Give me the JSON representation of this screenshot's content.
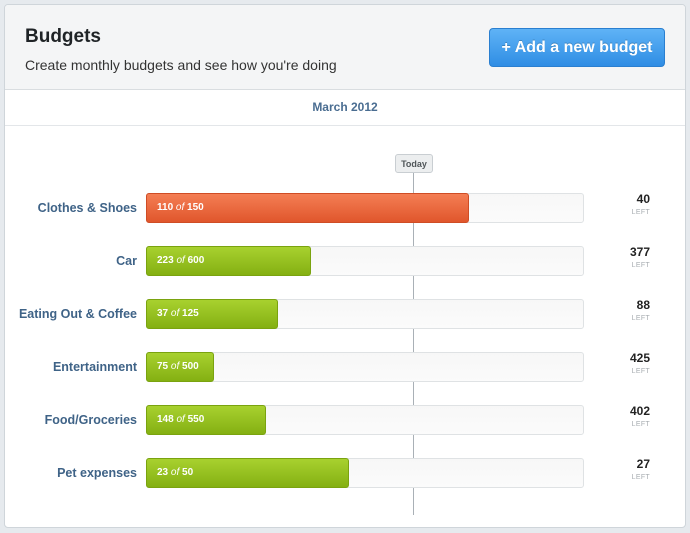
{
  "header": {
    "title": "Budgets",
    "subtitle": "Create monthly budgets and see how you're doing",
    "add_button": "+ Add a new budget"
  },
  "month": "March 2012",
  "today_label": "Today",
  "today_fraction": 0.6,
  "left_label": "LEFT",
  "budgets": [
    {
      "category": "Clothes & Shoes",
      "spent": "110",
      "of": "of",
      "total": "150",
      "left": "40",
      "status": "over-pace",
      "color": "#e8643a"
    },
    {
      "category": "Car",
      "spent": "223",
      "of": "of",
      "total": "600",
      "left": "377",
      "status": "ok",
      "color": "#95c11f"
    },
    {
      "category": "Eating Out & Coffee",
      "spent": "37",
      "of": "of",
      "total": "125",
      "left": "88",
      "status": "ok",
      "color": "#95c11f"
    },
    {
      "category": "Entertainment",
      "spent": "75",
      "of": "of",
      "total": "500",
      "left": "425",
      "status": "ok",
      "color": "#95c11f"
    },
    {
      "category": "Food/Groceries",
      "spent": "148",
      "of": "of",
      "total": "550",
      "left": "402",
      "status": "ok",
      "color": "#95c11f"
    },
    {
      "category": "Pet expenses",
      "spent": "23",
      "of": "of",
      "total": "50",
      "left": "27",
      "status": "ok",
      "color": "#95c11f"
    }
  ]
}
